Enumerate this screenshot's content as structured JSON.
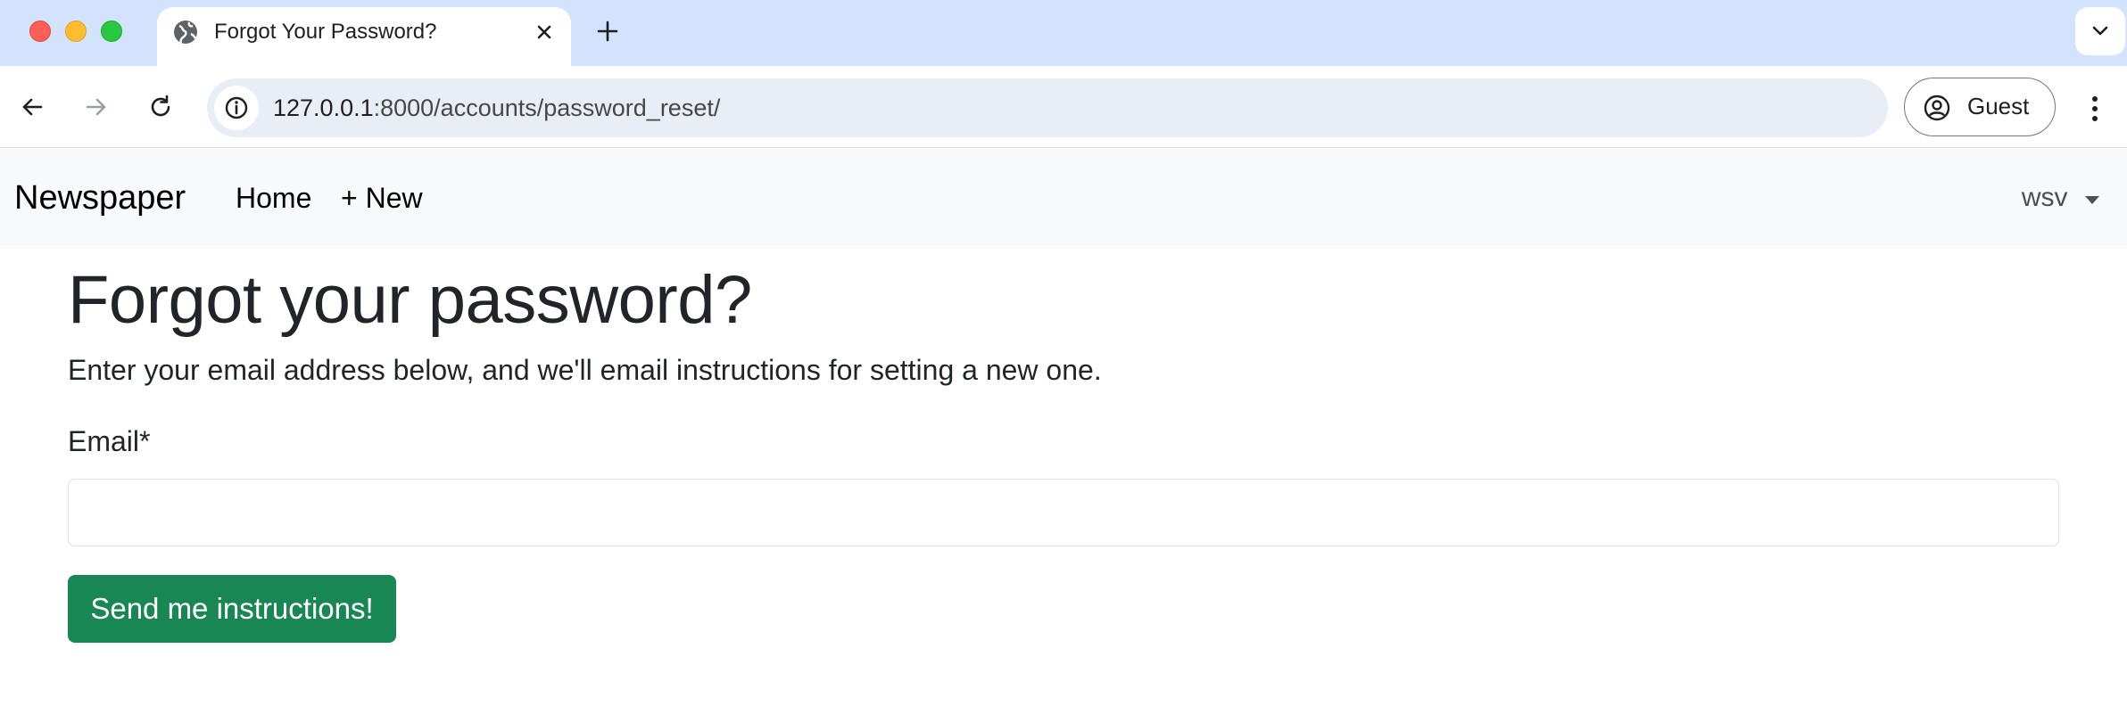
{
  "browser": {
    "tab": {
      "title": "Forgot Your Password?",
      "icon": "globe-icon"
    },
    "address_bar": {
      "url_host": "127.0.0.1",
      "url_path": ":8000/accounts/password_reset/"
    },
    "profile": {
      "label": "Guest"
    }
  },
  "navbar": {
    "brand": "Newspaper",
    "links": [
      {
        "label": "Home"
      },
      {
        "label": "+ New"
      }
    ],
    "user_menu": {
      "label": "wsv"
    }
  },
  "main": {
    "title": "Forgot your password?",
    "lead": "Enter your email address below, and we'll email instructions for setting a new one.",
    "email_label": "Email*",
    "email_value": "",
    "submit_label": "Send me instructions!"
  },
  "colors": {
    "tabstrip": "#d3e3fd",
    "navbar_bg": "#f8f9fa",
    "submit_button": "#198754"
  }
}
